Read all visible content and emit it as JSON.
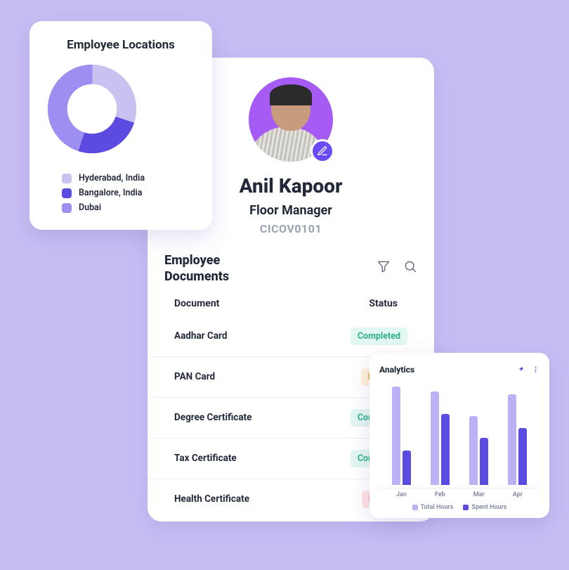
{
  "profile": {
    "name": "Anil Kapoor",
    "role": "Floor Manager",
    "code": "CICOV0101"
  },
  "documents": {
    "title": "Employee Documents",
    "col_document": "Document",
    "col_status": "Status",
    "rows": [
      {
        "name": "Aadhar Card",
        "status": "Completed",
        "status_class": "status-completed"
      },
      {
        "name": "PAN Card",
        "status": "Pending",
        "status_class": "status-pending"
      },
      {
        "name": "Degree Certificate",
        "status": "Completed",
        "status_class": "status-completed"
      },
      {
        "name": "Tax Certificate",
        "status": "Completed",
        "status_class": "status-completed"
      },
      {
        "name": "Health Certificate",
        "status": "Blocked",
        "status_class": "status-blocked"
      }
    ]
  },
  "locations": {
    "title": "Employee Locations",
    "items": [
      {
        "label": "Hyderabad, India",
        "color": "#C9C2F1"
      },
      {
        "label": "Bangalore, India",
        "color": "#5B4BE0"
      },
      {
        "label": "Dubai",
        "color": "#9D8FF1"
      }
    ]
  },
  "analytics": {
    "title": "Analytics",
    "legend_total": "Total Hours",
    "legend_spent": "Spent Hours"
  },
  "chart_data": [
    {
      "type": "pie",
      "title": "Employee Locations",
      "categories": [
        "Hyderabad, India",
        "Bangalore, India",
        "Dubai"
      ],
      "values": [
        30,
        25,
        45
      ],
      "colors": [
        "#C9C2F1",
        "#5B4BE0",
        "#9D8FF1"
      ],
      "donut": true
    },
    {
      "type": "bar",
      "title": "Analytics",
      "categories": [
        "Jan",
        "Feb",
        "Mar",
        "Apr"
      ],
      "series": [
        {
          "name": "Total Hours",
          "values": [
            100,
            95,
            70,
            92
          ],
          "color": "#BDB1F5"
        },
        {
          "name": "Spent Hours",
          "values": [
            35,
            72,
            48,
            58
          ],
          "color": "#5B4BE0"
        }
      ],
      "ylim": [
        0,
        100
      ]
    }
  ]
}
